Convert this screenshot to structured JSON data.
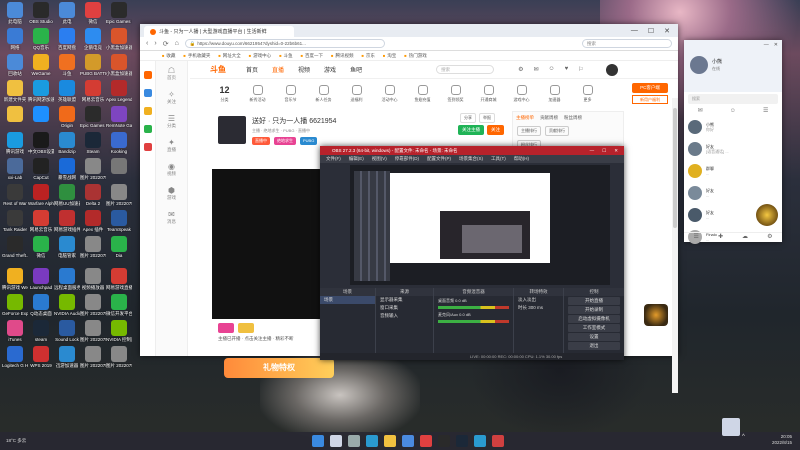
{
  "desktop": {
    "icons": [
      {
        "label": "此电脑",
        "color": "#4b8ad8"
      },
      {
        "label": "OBS Studio",
        "color": "#2a2a2a"
      },
      {
        "label": "此电",
        "color": "#4b8ad8"
      },
      {
        "label": "微信",
        "color": "#e04040"
      },
      {
        "label": "Epic Games Launcher",
        "color": "#2b2b2b"
      },
      {
        "label": "网络",
        "color": "#3a7bd5"
      },
      {
        "label": "QQ音乐",
        "color": "#2ab34a"
      },
      {
        "label": "百度网盘",
        "color": "#2b7ef0"
      },
      {
        "label": "企鹅电竞",
        "color": "#2d8cf0"
      },
      {
        "label": "小黑盒加速器",
        "color": "#d9552b"
      },
      {
        "label": "回收站",
        "color": "#4b8ad8"
      },
      {
        "label": "WeGame",
        "color": "#f0b020"
      },
      {
        "label": "斗鱼",
        "color": "#f07020"
      },
      {
        "label": "PUBG BATTLEGR...",
        "color": "#d39a2a"
      },
      {
        "label": "小黑盒加速器",
        "color": "#d9552b"
      },
      {
        "label": "新建文件夹",
        "color": "#f0c040"
      },
      {
        "label": "腾讯网游加速器",
        "color": "#1a9be0"
      },
      {
        "label": "英雄联盟",
        "color": "#1a8adf"
      },
      {
        "label": "网易云音乐",
        "color": "#d43c33"
      },
      {
        "label": "Apex Legends",
        "color": "#b32a2a"
      },
      {
        "label": "",
        "color": "#f0c040"
      },
      {
        "label": "",
        "color": "#1e90ff"
      },
      {
        "label": "Origin",
        "color": "#f06a1a"
      },
      {
        "label": "Epic Games Launcher",
        "color": "#2b2b2b"
      },
      {
        "label": "RemNote Gaming",
        "color": "#7e45c0"
      },
      {
        "label": "腾讯游戏",
        "color": "#1a9be0"
      },
      {
        "label": "中文OBS设置",
        "color": "#1a1a1a"
      },
      {
        "label": "Bandizip",
        "color": "#2a8ad0"
      },
      {
        "label": "Steam",
        "color": "#1b2838"
      },
      {
        "label": "Kooking",
        "color": "#3a6ad0"
      },
      {
        "label": "xxi-Lab",
        "color": "#4b6a9a"
      },
      {
        "label": "CapCut",
        "color": "#222"
      },
      {
        "label": "暴雪战网",
        "color": "#1a6ad8"
      },
      {
        "label": "图片 2022075...",
        "color": "#888"
      },
      {
        "label": "",
        "color": "#777"
      },
      {
        "label": "Rest of War",
        "color": "#3a3a3a"
      },
      {
        "label": "Warfare Alpha",
        "color": "#b22"
      },
      {
        "label": "网易UU加速器",
        "color": "#2f8f3f"
      },
      {
        "label": "Delta 2",
        "color": "#aa3333"
      },
      {
        "label": "图片 2022075...",
        "color": "#888"
      },
      {
        "label": "Tank Raider",
        "color": "#3a3a3a"
      },
      {
        "label": "网易云音乐",
        "color": "#d43c33"
      },
      {
        "label": "网易游戏插件",
        "color": "#c03030"
      },
      {
        "label": "Apex 插件",
        "color": "#b32a2a"
      },
      {
        "label": "TeamSpeak",
        "color": "#2a5aa0"
      },
      {
        "label": "Grand Theft...",
        "color": "#2a2a2a"
      },
      {
        "label": "微信",
        "color": "#2ab34a"
      },
      {
        "label": "电脑管家",
        "color": "#2a8ad0"
      },
      {
        "label": "图片 2022075...",
        "color": "#888"
      },
      {
        "label": "Dia",
        "color": "#2ab34a"
      },
      {
        "label": "腾讯游戏 WeGame",
        "color": "#f0b020"
      },
      {
        "label": "Launchpad",
        "color": "#7a3ac0"
      },
      {
        "label": "远程桌面服务",
        "color": "#2a7ad0"
      },
      {
        "label": "视频播放器",
        "color": "#888"
      },
      {
        "label": "网易游戏直播平台",
        "color": "#d43c33"
      },
      {
        "label": "GeForce Experience",
        "color": "#76b900"
      },
      {
        "label": "Q动态桌面",
        "color": "#2a7ad0"
      },
      {
        "label": "NVIDIA Audio",
        "color": "#76b900"
      },
      {
        "label": "图片 2022075...",
        "color": "#888"
      },
      {
        "label": "微信开发平台",
        "color": "#2ab34a"
      },
      {
        "label": "iTunes",
        "color": "#e04a8a"
      },
      {
        "label": "steam",
        "color": "#1b2838"
      },
      {
        "label": "Sound Lock",
        "color": "#2a5aa0"
      },
      {
        "label": "图片 2022075...",
        "color": "#888"
      },
      {
        "label": "NVIDIA 控制面板",
        "color": "#76b900"
      },
      {
        "label": "Logitech G HUB",
        "color": "#2a6ad0"
      },
      {
        "label": "WPS 2019",
        "color": "#d03030"
      },
      {
        "label": "迅游加速器",
        "color": "#2a8ad0"
      },
      {
        "label": "图片 2022075...",
        "color": "#888"
      },
      {
        "label": "图片 2022075...",
        "color": "#888"
      }
    ]
  },
  "browser": {
    "tab_title": "斗鱼 - 只为一人播 | 大型游戏直播平台 | 生活新鲜",
    "url": "https://www.douyu.com/6621954?dyshid=0-22b6b61...",
    "bookmarks": [
      "收藏",
      "手机收藏夹",
      "网址大全",
      "游戏中心",
      "斗鱼",
      "百度一下",
      "腾讯视频",
      "京东",
      "淘宝",
      "热门游戏"
    ],
    "addr_search_placeholder": "搜索",
    "window_controls": [
      "—",
      "☐",
      "✕"
    ],
    "nav_buttons": [
      "‹",
      "›",
      "⟳",
      "⌂"
    ]
  },
  "site": {
    "logo": "斗鱼",
    "nav": [
      "首页",
      "直播",
      "视频",
      "游戏",
      "鱼吧"
    ],
    "search_placeholder": "搜索",
    "header_icons": [
      "⚙",
      "✉",
      "☺",
      "♥",
      "⚐"
    ],
    "categories": [
      {
        "label": "12",
        "sub": "分类"
      },
      {
        "label": "新秀",
        "sub": "新秀活动"
      },
      {
        "label": "音乐",
        "sub": "音乐节"
      },
      {
        "label": "任务",
        "sub": "新人任务"
      },
      {
        "label": "送福利",
        "sub": "送福利"
      },
      {
        "label": "活动",
        "sub": "活动中心"
      },
      {
        "label": "鱼翅",
        "sub": "鱼翅充值"
      },
      {
        "label": "签到",
        "sub": "签到领奖"
      },
      {
        "label": "商城",
        "sub": "开通商城"
      },
      {
        "label": "游戏",
        "sub": "游戏中心"
      },
      {
        "label": "加速",
        "sub": "加速器"
      },
      {
        "label": "更多",
        "sub": "更多"
      }
    ],
    "pc_button": "PC客户端",
    "promo": "新用户福利"
  },
  "stream": {
    "title": "送好 · 只为一人播",
    "room_id": "6621954",
    "sub": "主播 · 绝地求生 · PUBG · 直播中",
    "tags": [
      {
        "label": "直播中",
        "color": "#ff5a3a"
      },
      {
        "label": "绝地求生",
        "color": "#e84393"
      },
      {
        "label": "PUBG",
        "color": "#2a8ad0"
      }
    ],
    "share": [
      "分享",
      "举报"
    ],
    "follow": [
      {
        "label": "关注主播",
        "color": "#1fb356"
      },
      {
        "label": "关注",
        "color": "#f60"
      }
    ]
  },
  "rank_panel": {
    "tabs": [
      "主播榜单",
      "贡献周榜",
      "粉丝周榜"
    ],
    "buttons": [
      "主播排行",
      "贡献排行",
      "粉丝排行"
    ]
  },
  "below_video": {
    "line": "主播已开播 · 点击关注主播 · 精彩不断"
  },
  "gift_banner": "礼物特权",
  "sidebar_left": [
    {
      "icon": "☖",
      "label": "首页"
    },
    {
      "icon": "✧",
      "label": "关注"
    },
    {
      "icon": "☰",
      "label": "分类"
    },
    {
      "icon": "✦",
      "label": "直播"
    },
    {
      "icon": "◉",
      "label": "视频"
    },
    {
      "icon": "⬢",
      "label": "游戏"
    },
    {
      "icon": "✉",
      "label": "消息"
    }
  ],
  "obs": {
    "title": "OBS 27.2.3 (64-bit, windows) - 配置文件: 未命名 - 场景: 未命名",
    "menu": [
      "文件(F)",
      "编辑(E)",
      "视图(V)",
      "停靠部件(D)",
      "配置文件(P)",
      "场景集合(S)",
      "工具(T)",
      "帮助(H)"
    ],
    "controls": [
      "—",
      "☐",
      "✕"
    ],
    "docks": {
      "scenes": {
        "header": "场景",
        "items": [
          "场景"
        ]
      },
      "sources": {
        "header": "来源",
        "items": [
          "显示器采集",
          "窗口采集",
          "音频输入"
        ]
      },
      "mixer": {
        "header": "音频混音器",
        "items": [
          "桌面音频 0.0 dB",
          "麦克风/Aux 0.0 dB"
        ]
      },
      "transitions": {
        "header": "转场特效",
        "items": [
          "淡入淡出",
          "时长 300 ms"
        ]
      },
      "controls": {
        "header": "控制",
        "items": [
          "开始直播",
          "开始录制",
          "启动虚拟摄像机",
          "工作室模式",
          "设置",
          "退出"
        ]
      }
    },
    "status": "LIVE: 00:00:00  REC: 00:00:00  CPU: 1.1%  30.00 fps"
  },
  "chat": {
    "name": "小熊",
    "status": "在线",
    "search_placeholder": "搜索",
    "tabs": [
      "✉",
      "☺",
      "☰"
    ],
    "contacts": [
      {
        "name": "小熊",
        "msg": "你好",
        "color": "#5a6a7a"
      },
      {
        "name": "好友",
        "msg": "[语音通话] ...",
        "color": "#6a7a8a"
      },
      {
        "name": "群聊",
        "msg": "...",
        "color": "#e0b020"
      },
      {
        "name": "好友",
        "msg": "...",
        "color": "#7a8a9a"
      },
      {
        "name": "好友",
        "msg": "...",
        "color": "#4a5a6a"
      },
      {
        "name": "Finalo",
        "msg": "...",
        "color": "#aaa"
      }
    ],
    "bottom_icons": [
      "☰",
      "✚",
      "☁",
      "⚙"
    ]
  },
  "taskbar": {
    "weather": "18°C 多云",
    "time": "20:05",
    "date": "2022/8/15",
    "icons": [
      {
        "name": "windows-start-icon",
        "color": "#3a8ae0"
      },
      {
        "name": "search-icon",
        "color": "#cfd6e6"
      },
      {
        "name": "taskview-icon",
        "color": "#9aa"
      },
      {
        "name": "edge-icon",
        "color": "#2a9ad0"
      },
      {
        "name": "explorer-icon",
        "color": "#f0c040"
      },
      {
        "name": "store-icon",
        "color": "#4a8ae0"
      },
      {
        "name": "browser-icon",
        "color": "#e04040"
      },
      {
        "name": "obs-icon",
        "color": "#2a2a2a"
      },
      {
        "name": "steam-icon",
        "color": "#1b2838"
      },
      {
        "name": "qq-icon",
        "color": "#2a9ad0"
      },
      {
        "name": "game-icon",
        "color": "#d04040"
      }
    ]
  }
}
